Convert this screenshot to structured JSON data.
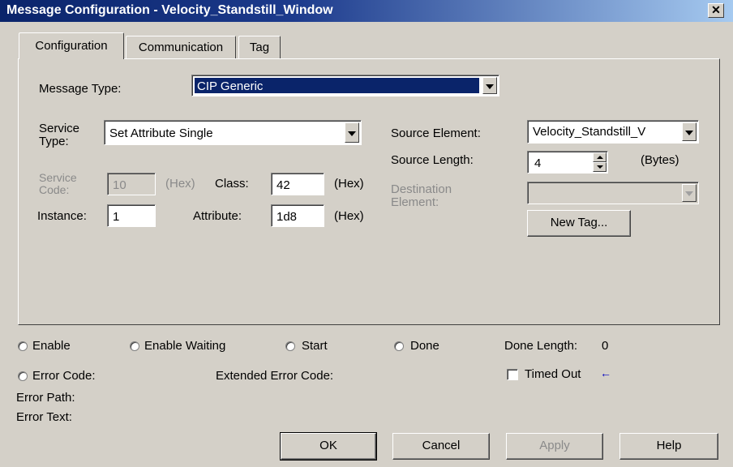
{
  "window": {
    "title": "Message Configuration - Velocity_Standstill_Window",
    "close_glyph": "✕"
  },
  "tabs": [
    {
      "label": "Configuration",
      "active": true
    },
    {
      "label": "Communication",
      "active": false
    },
    {
      "label": "Tag",
      "active": false
    }
  ],
  "config": {
    "message_type_label": "Message Type:",
    "message_type_value": "CIP Generic",
    "service_type_label": "Service\nType:",
    "service_type_value": "Set Attribute Single",
    "service_code_label": "Service\nCode:",
    "service_code_value": "10",
    "service_code_unit": "(Hex)",
    "class_label": "Class:",
    "class_value": "42",
    "class_unit": "(Hex)",
    "instance_label": "Instance:",
    "instance_value": "1",
    "attribute_label": "Attribute:",
    "attribute_value": "1d8",
    "attribute_unit": "(Hex)",
    "source_element_label": "Source Element:",
    "source_element_value": "Velocity_Standstill_V",
    "source_length_label": "Source Length:",
    "source_length_value": "4",
    "source_length_unit": "(Bytes)",
    "destination_element_label": "Destination\nElement:",
    "destination_element_value": "",
    "new_tag_label": "New Tag..."
  },
  "status": {
    "enable": "Enable",
    "enable_waiting": "Enable Waiting",
    "start": "Start",
    "done": "Done",
    "done_length_label": "Done Length:",
    "done_length_value": "0",
    "error_code": "Error Code:",
    "extended_error_code": "Extended Error Code:",
    "timed_out": "Timed Out",
    "timed_out_checked": false,
    "timed_out_arrow": "←",
    "error_path": "Error Path:",
    "error_text": "Error Text:"
  },
  "buttons": {
    "ok": "OK",
    "cancel": "Cancel",
    "apply": "Apply",
    "help": "Help"
  },
  "colors": {
    "titlebar_start": "#0a246a",
    "titlebar_end": "#a6caf0",
    "selection": "#0a246a",
    "dialog_bg": "#d4d0c8"
  }
}
